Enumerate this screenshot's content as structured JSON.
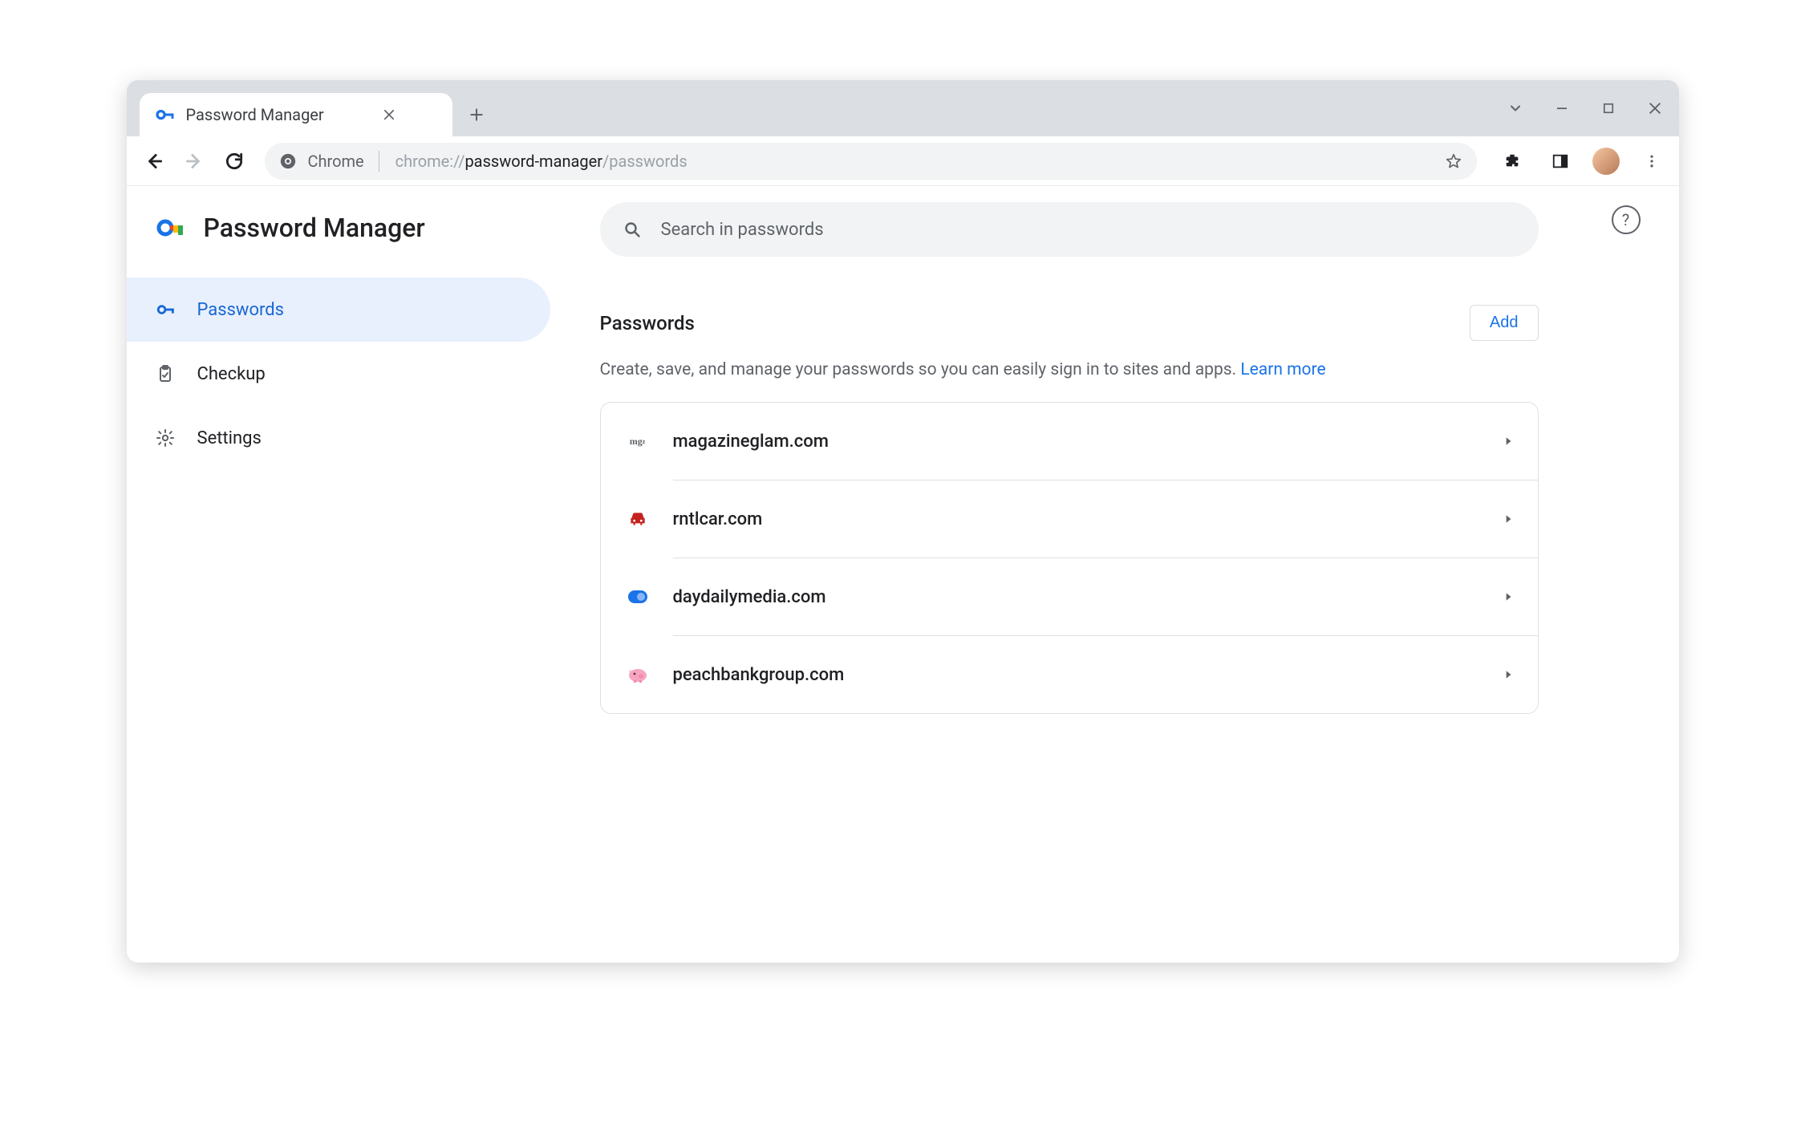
{
  "tab": {
    "title": "Password Manager"
  },
  "omnibox": {
    "label": "Chrome",
    "url_prefix": "chrome://",
    "url_bold": "password-manager",
    "url_suffix": "/passwords"
  },
  "page": {
    "title": "Password Manager",
    "search_placeholder": "Search in passwords",
    "help_label": "?"
  },
  "sidebar": {
    "items": [
      {
        "label": "Passwords"
      },
      {
        "label": "Checkup"
      },
      {
        "label": "Settings"
      }
    ]
  },
  "section": {
    "title": "Passwords",
    "add_label": "Add",
    "description": "Create, save, and manage your passwords so you can easily sign in to sites and apps.",
    "learn_more": "Learn more"
  },
  "passwords": [
    {
      "domain": "magazineglam.com",
      "favicon": "mg",
      "favicon_color": "#5f6368",
      "favicon_type": "text"
    },
    {
      "domain": "rntlcar.com",
      "favicon": "car",
      "favicon_color": "#c5221f",
      "favicon_type": "car"
    },
    {
      "domain": "daydailymedia.com",
      "favicon": "dot",
      "favicon_color": "#1a73e8",
      "favicon_type": "pill"
    },
    {
      "domain": "peachbankgroup.com",
      "favicon": "pig",
      "favicon_color": "#f28bb1",
      "favicon_type": "pig"
    }
  ],
  "colors": {
    "accent": "#1a73e8",
    "active_bg": "#e8f0fe",
    "text": "#202124",
    "muted": "#5f6368"
  }
}
